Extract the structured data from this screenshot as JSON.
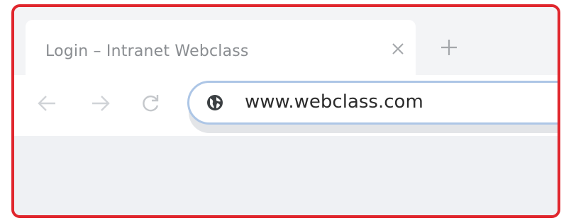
{
  "tab": {
    "title": "Login – Intranet Webclass",
    "close_icon": "close-icon",
    "new_tab_icon": "plus-icon"
  },
  "toolbar": {
    "back_icon": "arrow-left-icon",
    "forward_icon": "arrow-right-icon",
    "reload_icon": "reload-icon"
  },
  "address_bar": {
    "site_icon": "globe-icon",
    "url": "www.webclass.com"
  },
  "colors": {
    "highlight_border": "#e0262d",
    "omnibox_focus": "#adc6e6"
  }
}
